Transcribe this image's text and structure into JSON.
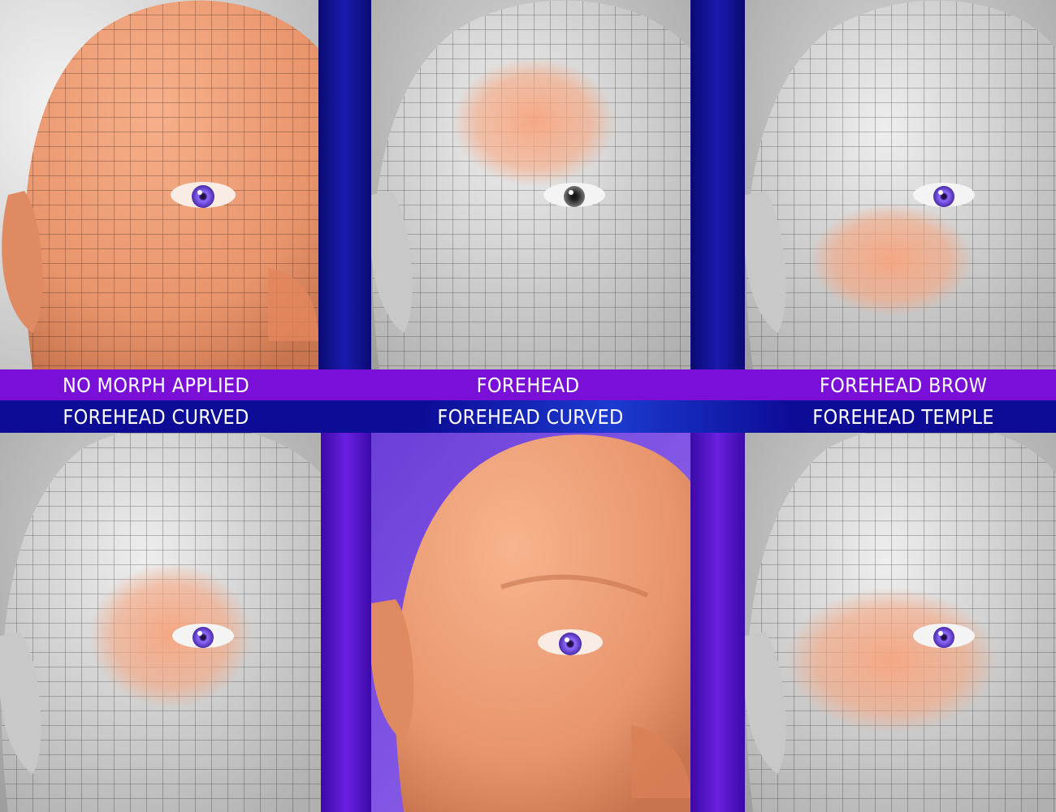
{
  "colors": {
    "band_top": "#7a10d8",
    "band_bottom": "#0c0c96",
    "divider_blue": "#12129a",
    "divider_purple": "#5a14c8",
    "skin": "#f0a27c",
    "highlight": "#f6b48f",
    "iris": "#7c4df0",
    "grey_mesh": "#cfcfcf"
  },
  "panels": {
    "top": [
      {
        "id": "no-morph",
        "render": "skin-mesh",
        "highlight": "none"
      },
      {
        "id": "forehead",
        "render": "grey-mesh",
        "highlight": "forehead"
      },
      {
        "id": "forehead-brow",
        "render": "grey-mesh",
        "highlight": "brow"
      }
    ],
    "bottom": [
      {
        "id": "forehead-curved-mesh",
        "render": "grey-mesh",
        "highlight": "curved"
      },
      {
        "id": "forehead-curved-render",
        "render": "skin-smooth",
        "highlight": "none"
      },
      {
        "id": "forehead-temple",
        "render": "grey-mesh",
        "highlight": "temple"
      }
    ]
  },
  "labels": {
    "top": [
      "NO MORPH APPLIED",
      "FOREHEAD",
      "FOREHEAD BROW"
    ],
    "bottom": [
      "FOREHEAD CURVED",
      "FOREHEAD CURVED",
      "FOREHEAD TEMPLE"
    ]
  }
}
